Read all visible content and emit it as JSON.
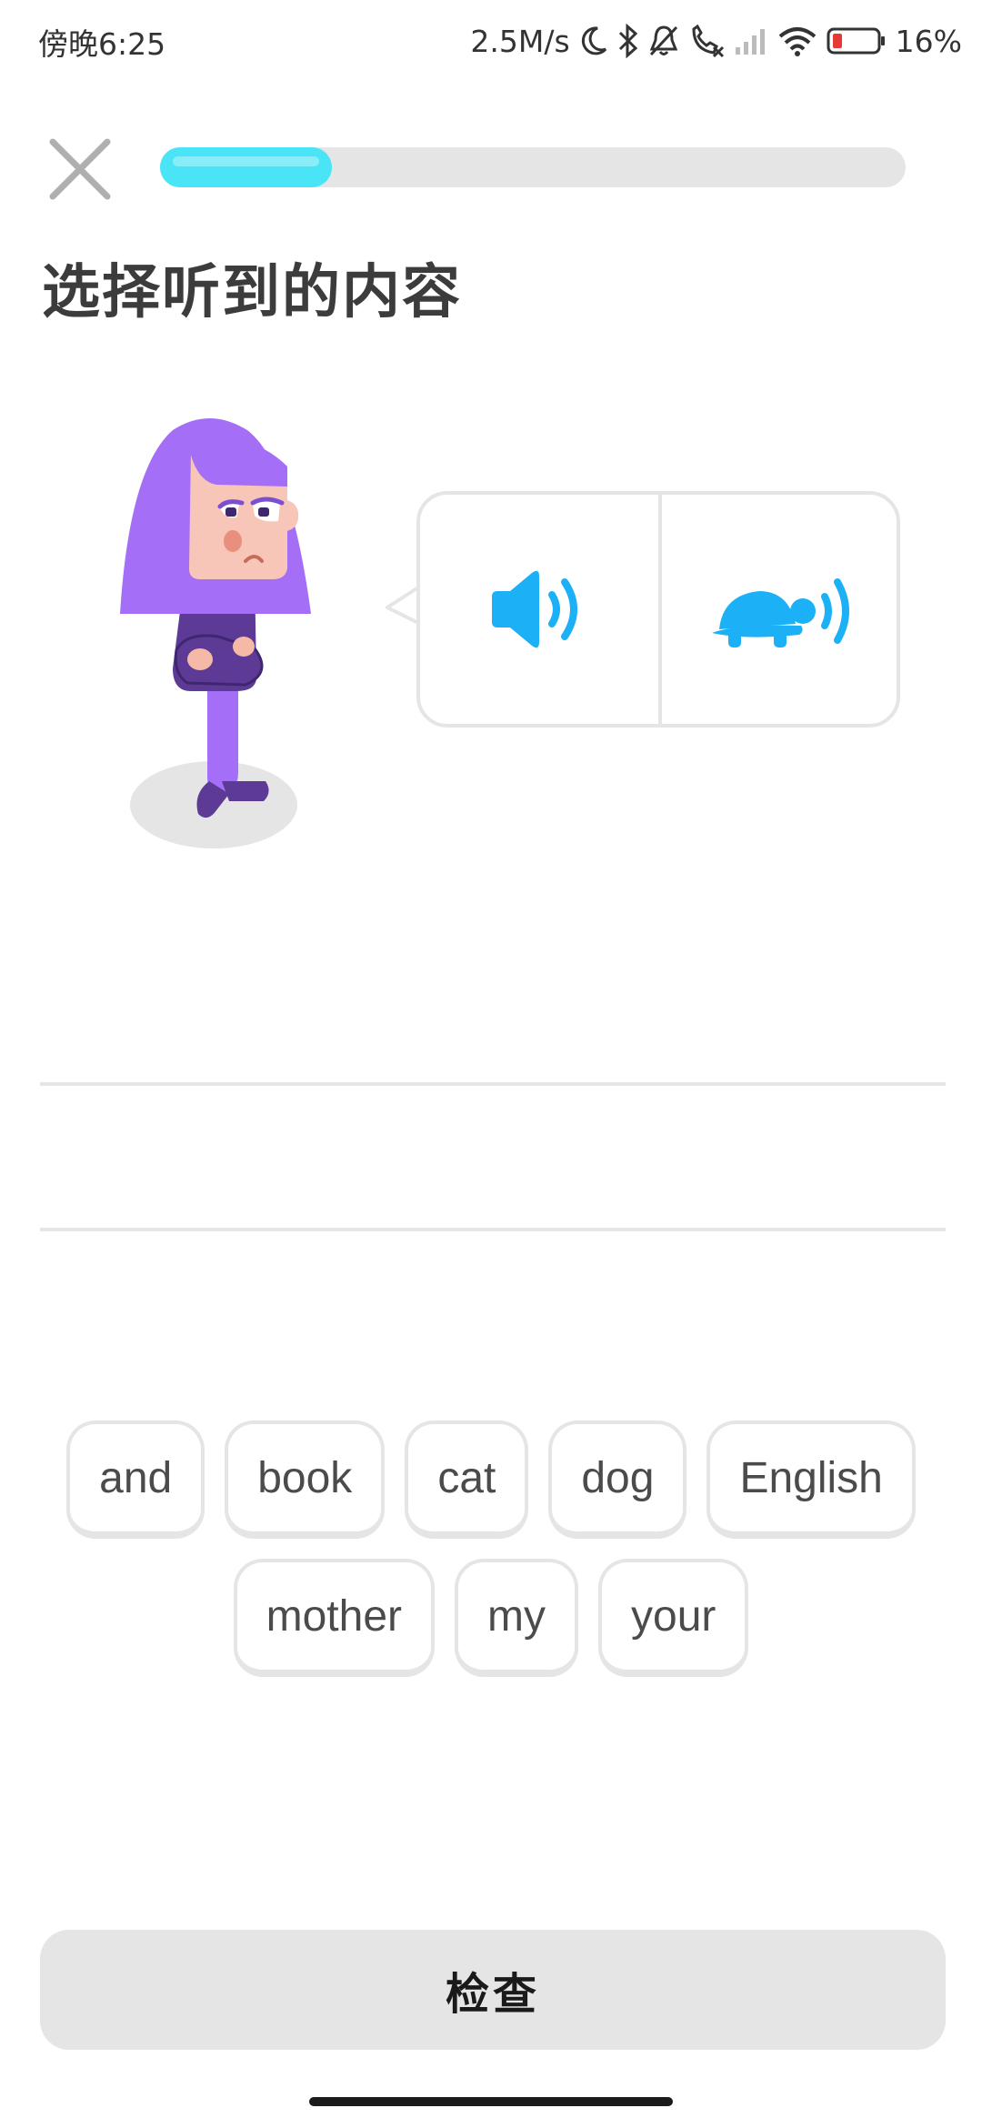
{
  "status_bar": {
    "time": "傍晚6:25",
    "network_speed": "2.5M/s",
    "battery": "16%",
    "icons": [
      "moon-icon",
      "bluetooth-icon",
      "bell-off-icon",
      "call-off-icon",
      "signal-icon",
      "wifi-icon",
      "battery-icon"
    ],
    "battery_color": "#e53935"
  },
  "header": {
    "close_icon": "close-icon",
    "progress": 0.23,
    "progress_color": "#49e4f5"
  },
  "title": "选择听到的内容",
  "audio": {
    "normal_icon": "speaker-icon",
    "slow_icon": "turtle-speaker-icon",
    "accent": "#1cb0f6"
  },
  "word_bank": {
    "row1": [
      "and",
      "book",
      "cat",
      "dog",
      "English"
    ],
    "row2": [
      "mother",
      "my",
      "your"
    ]
  },
  "check_button": "检查"
}
